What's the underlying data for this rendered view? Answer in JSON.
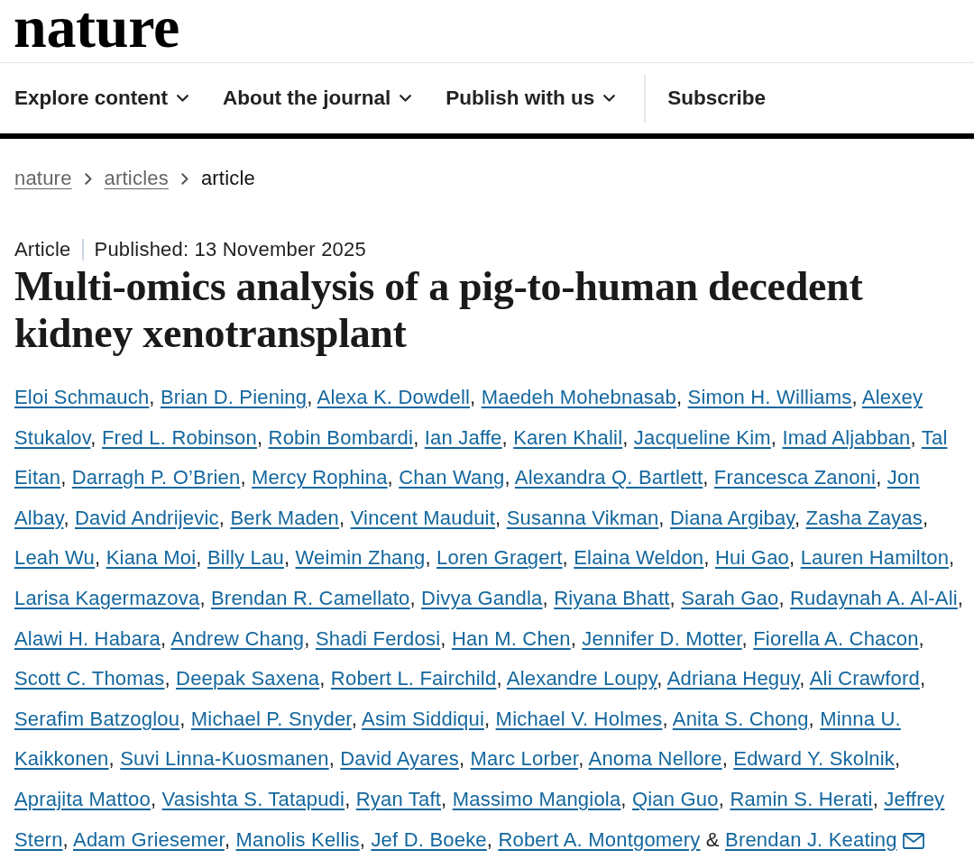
{
  "header": {
    "logo": "nature"
  },
  "nav": {
    "items": [
      {
        "label": "Explore content",
        "dropdown": true
      },
      {
        "label": "About the journal",
        "dropdown": true
      },
      {
        "label": "Publish with us",
        "dropdown": true
      },
      {
        "label": "Subscribe",
        "dropdown": false
      }
    ]
  },
  "breadcrumb": [
    {
      "label": "nature",
      "link": true
    },
    {
      "label": "articles",
      "link": true
    },
    {
      "label": "article",
      "link": false
    }
  ],
  "article": {
    "type": "Article",
    "published": "Published: 13 November 2025",
    "title": "Multi-omics analysis of a pig-to-human decedent kidney xenotransplant",
    "author_lines": [
      [
        {
          "name": "Eloi Schmauch",
          "sep": ","
        },
        {
          "name": "Brian D. Piening",
          "sep": ","
        },
        {
          "name": "Alexa K. Dowdell",
          "sep": ","
        },
        {
          "name": "Maedeh Mohebnasab",
          "sep": ","
        },
        {
          "name": "Simon H. Williams",
          "sep": ","
        },
        {
          "name": "Alexey"
        }
      ],
      [
        {
          "name": "Stukalov",
          "sep": ","
        },
        {
          "name": "Fred L. Robinson",
          "sep": ","
        },
        {
          "name": "Robin Bombardi",
          "sep": ","
        },
        {
          "name": "Ian Jaffe",
          "sep": ","
        },
        {
          "name": "Karen Khalil",
          "sep": ","
        },
        {
          "name": "Jacqueline Kim",
          "sep": ","
        },
        {
          "name": "Imad Aljabban",
          "sep": ","
        },
        {
          "name": "Tal"
        }
      ],
      [
        {
          "name": "Eitan",
          "sep": ","
        },
        {
          "name": "Darragh P. O’Brien",
          "sep": ","
        },
        {
          "name": "Mercy Rophina",
          "sep": ","
        },
        {
          "name": "Chan Wang",
          "sep": ","
        },
        {
          "name": "Alexandra Q. Bartlett",
          "sep": ","
        },
        {
          "name": "Francesca Zanoni",
          "sep": ","
        },
        {
          "name": "Jon"
        }
      ],
      [
        {
          "name": "Albay",
          "sep": ","
        },
        {
          "name": "David Andrijevic",
          "sep": ","
        },
        {
          "name": "Berk Maden",
          "sep": ","
        },
        {
          "name": "Vincent Mauduit",
          "sep": ","
        },
        {
          "name": "Susanna Vikman",
          "sep": ","
        },
        {
          "name": "Diana Argibay",
          "sep": ","
        },
        {
          "name": "Zasha Zayas",
          "sep": ","
        }
      ],
      [
        {
          "name": "Leah Wu",
          "sep": ","
        },
        {
          "name": "Kiana Moi",
          "sep": ","
        },
        {
          "name": "Billy Lau",
          "sep": ","
        },
        {
          "name": "Weimin Zhang",
          "sep": ","
        },
        {
          "name": "Loren Gragert",
          "sep": ","
        },
        {
          "name": "Elaina Weldon",
          "sep": ","
        },
        {
          "name": "Hui Gao",
          "sep": ","
        },
        {
          "name": "Lauren Hamilton",
          "sep": ","
        }
      ],
      [
        {
          "name": "Larisa Kagermazova",
          "sep": ","
        },
        {
          "name": "Brendan R. Camellato",
          "sep": ","
        },
        {
          "name": "Divya Gandla",
          "sep": ","
        },
        {
          "name": "Riyana Bhatt",
          "sep": ","
        },
        {
          "name": "Sarah Gao",
          "sep": ","
        },
        {
          "name": "Rudaynah A. Al-Ali",
          "sep": ","
        }
      ],
      [
        {
          "name": "Alawi H. Habara",
          "sep": ","
        },
        {
          "name": "Andrew Chang",
          "sep": ","
        },
        {
          "name": "Shadi Ferdosi",
          "sep": ","
        },
        {
          "name": "Han M. Chen",
          "sep": ","
        },
        {
          "name": "Jennifer D. Motter",
          "sep": ","
        },
        {
          "name": "Fiorella A. Chacon",
          "sep": ","
        }
      ],
      [
        {
          "name": "Scott C. Thomas",
          "sep": ","
        },
        {
          "name": "Deepak Saxena",
          "sep": ","
        },
        {
          "name": "Robert L. Fairchild",
          "sep": ","
        },
        {
          "name": "Alexandre Loupy",
          "sep": ","
        },
        {
          "name": "Adriana Heguy",
          "sep": ","
        },
        {
          "name": "Ali Crawford",
          "sep": ","
        }
      ],
      [
        {
          "name": "Serafim Batzoglou",
          "sep": ","
        },
        {
          "name": "Michael P. Snyder",
          "sep": ","
        },
        {
          "name": "Asim Siddiqui",
          "sep": ","
        },
        {
          "name": "Michael V. Holmes",
          "sep": ","
        },
        {
          "name": "Anita S. Chong",
          "sep": ","
        },
        {
          "name": "Minna U."
        }
      ],
      [
        {
          "name": "Kaikkonen",
          "sep": ","
        },
        {
          "name": "Suvi Linna-Kuosmanen",
          "sep": ","
        },
        {
          "name": "David Ayares",
          "sep": ","
        },
        {
          "name": "Marc Lorber",
          "sep": ","
        },
        {
          "name": "Anoma Nellore",
          "sep": ","
        },
        {
          "name": "Edward Y. Skolnik",
          "sep": ","
        }
      ],
      [
        {
          "name": "Aprajita Mattoo",
          "sep": ","
        },
        {
          "name": "Vasishta S. Tatapudi",
          "sep": ","
        },
        {
          "name": "Ryan Taft",
          "sep": ","
        },
        {
          "name": "Massimo Mangiola",
          "sep": ","
        },
        {
          "name": "Qian Guo",
          "sep": ","
        },
        {
          "name": "Ramin S. Herati",
          "sep": ","
        },
        {
          "name": "Jeffrey"
        }
      ],
      [
        {
          "name": "Stern",
          "sep": ","
        },
        {
          "name": "Adam Griesemer",
          "sep": ","
        },
        {
          "name": "Manolis Kellis",
          "sep": ","
        },
        {
          "name": "Jef D. Boeke",
          "sep": ","
        },
        {
          "name": "Robert A. Montgomery",
          "sep": " &"
        },
        {
          "name": "Brendan J. Keating",
          "email": true
        }
      ]
    ]
  }
}
